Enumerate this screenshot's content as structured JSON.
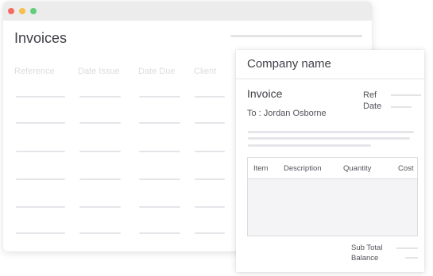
{
  "colors": {
    "dot_red": "#f56d5f",
    "dot_yellow": "#f7c04a",
    "dot_green": "#5fd079"
  },
  "window": {
    "title": "Invoices",
    "columns": [
      "Reference",
      "Date Issue",
      "Date Due",
      "Client"
    ]
  },
  "invoice_card": {
    "company": "Company name",
    "title": "Invoice",
    "to": "To : Jordan Osborne",
    "ref_label": "Ref",
    "date_label": "Date",
    "table_headers": [
      "Item",
      "Description",
      "Quantity",
      "Cost"
    ],
    "subtotal_label": "Sub Total",
    "balance_label": "Balance"
  }
}
